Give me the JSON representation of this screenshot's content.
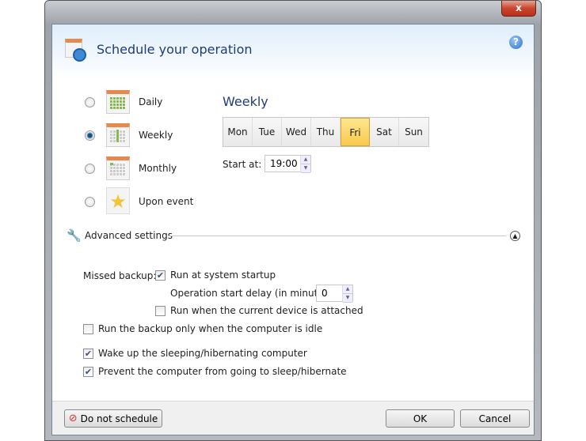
{
  "window": {
    "close_label": "x"
  },
  "header": {
    "title": "Schedule your operation",
    "help_icon": "help-icon"
  },
  "schedule_types": [
    {
      "label": "Daily",
      "selected": false,
      "icon": "calendar-daily-icon"
    },
    {
      "label": "Weekly",
      "selected": true,
      "icon": "calendar-weekly-icon"
    },
    {
      "label": "Monthly",
      "selected": false,
      "icon": "calendar-monthly-icon"
    },
    {
      "label": "Upon event",
      "selected": false,
      "icon": "star-event-icon"
    }
  ],
  "weekly": {
    "title": "Weekly",
    "days": [
      "Mon",
      "Tue",
      "Wed",
      "Thu",
      "Fri",
      "Sat",
      "Sun"
    ],
    "selected_day": "Fri",
    "start_label": "Start at:",
    "start_value": "19:00"
  },
  "advanced": {
    "title": "Advanced settings",
    "missed_label": "Missed backup:",
    "run_startup": {
      "label": "Run at system startup",
      "checked": true
    },
    "delay_label": "Operation start delay (in minutes):",
    "delay_value": "0",
    "run_attached": {
      "label": "Run when the current device is attached",
      "checked": false
    },
    "idle": {
      "label": "Run the backup only when the computer is idle",
      "checked": false
    },
    "wake": {
      "label": "Wake up the sleeping/hibernating computer",
      "checked": true
    },
    "prevent": {
      "label": "Prevent the computer from going to sleep/hibernate",
      "checked": true
    }
  },
  "footer": {
    "do_not_schedule": "Do not schedule",
    "ok": "OK",
    "cancel": "Cancel"
  },
  "colors": {
    "title": "#1e3c78",
    "selected_day": "#f8c94d"
  }
}
